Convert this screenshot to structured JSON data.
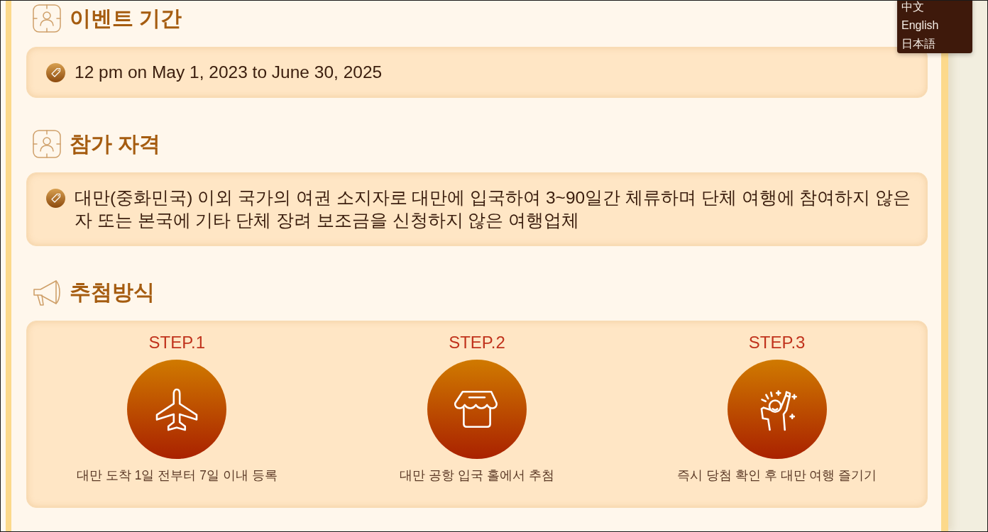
{
  "language_menu": {
    "items": [
      {
        "label": "中文"
      },
      {
        "label": "English"
      },
      {
        "label": "日本語"
      }
    ]
  },
  "sections": [
    {
      "kind": "info",
      "title": "이벤트 기간",
      "text": "12 pm on May 1, 2023 to June 30, 2025"
    },
    {
      "kind": "info",
      "title": "참가 자격",
      "text": "대만(중화민국) 이외 국가의 여권 소지자로 대만에 입국하여 3~90일간 체류하며 단체 여행에 참여하지 않은 자 또는 본국에 기타 단체 장려 보조금을 신청하지 않은 여행업체"
    },
    {
      "kind": "steps",
      "title": "추첨방식",
      "steps": [
        {
          "kind": "flight",
          "label": "STEP.1",
          "caption": "대만 도착 1일 전부터 7일 이내 등록"
        },
        {
          "kind": "store",
          "label": "STEP.2",
          "caption": "대만 공항 입국 홀에서 추첨"
        },
        {
          "kind": "celebrate",
          "label": "STEP.3",
          "caption": "즉시 당첨 확인 후 대만 여행 즐기기"
        }
      ]
    }
  ]
}
